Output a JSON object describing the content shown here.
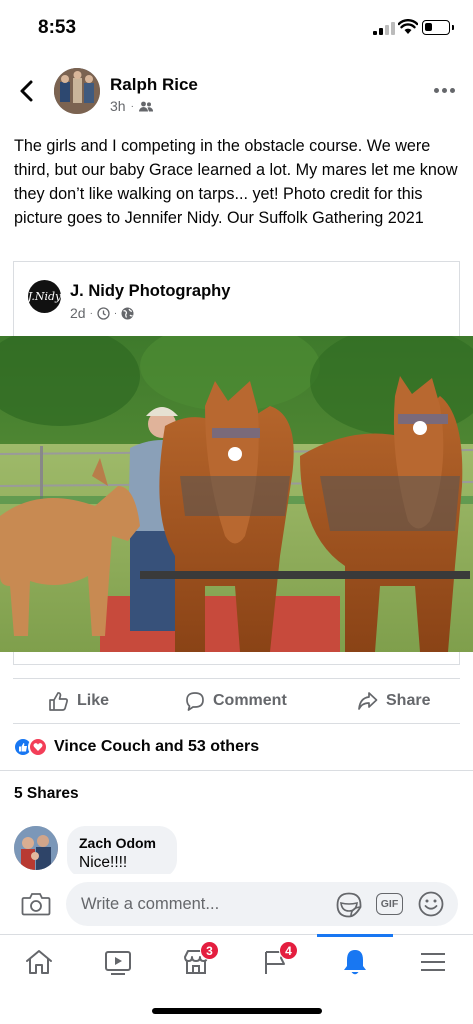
{
  "status_bar": {
    "time": "8:53",
    "battery_level": 0.35
  },
  "post": {
    "author": "Ralph Rice",
    "time_ago": "3h",
    "audience_icon": "friends-icon",
    "text": "The girls and I competing in the obstacle course. We were third, but our baby Grace learned a lot. My mares let me know they don’t like walking on tarps... yet! Photo credit for this picture goes to Jennifer Nidy. Our Suffolk Gathering 2021"
  },
  "shared": {
    "page_name": "J. Nidy Photography",
    "avatar_text": "J.Nidy",
    "time_ago": "2d",
    "meta_icons": [
      "clock-icon",
      "globe-icon"
    ]
  },
  "actions": {
    "like": "Like",
    "comment": "Comment",
    "share": "Share"
  },
  "reactions": {
    "text": "Vince Couch and 53 others",
    "types": [
      "like",
      "love"
    ]
  },
  "shares": "5 Shares",
  "comments": [
    {
      "author": "Zach Odom",
      "text": "Nice!!!!"
    }
  ],
  "composer": {
    "placeholder": "Write a comment...",
    "gif_label": "GIF"
  },
  "tabbar": {
    "tabs": [
      {
        "name": "home",
        "icon": "home-icon"
      },
      {
        "name": "watch",
        "icon": "video-icon"
      },
      {
        "name": "marketplace",
        "icon": "marketplace-icon",
        "badge": "3"
      },
      {
        "name": "pages",
        "icon": "flag-icon",
        "badge": "4"
      },
      {
        "name": "notifications",
        "icon": "bell-icon",
        "active": true
      },
      {
        "name": "menu",
        "icon": "menu-icon"
      }
    ]
  },
  "colors": {
    "accent": "#1877f2",
    "badge": "#e41e3f",
    "love": "#f33e58",
    "secondary_text": "#65676b"
  }
}
